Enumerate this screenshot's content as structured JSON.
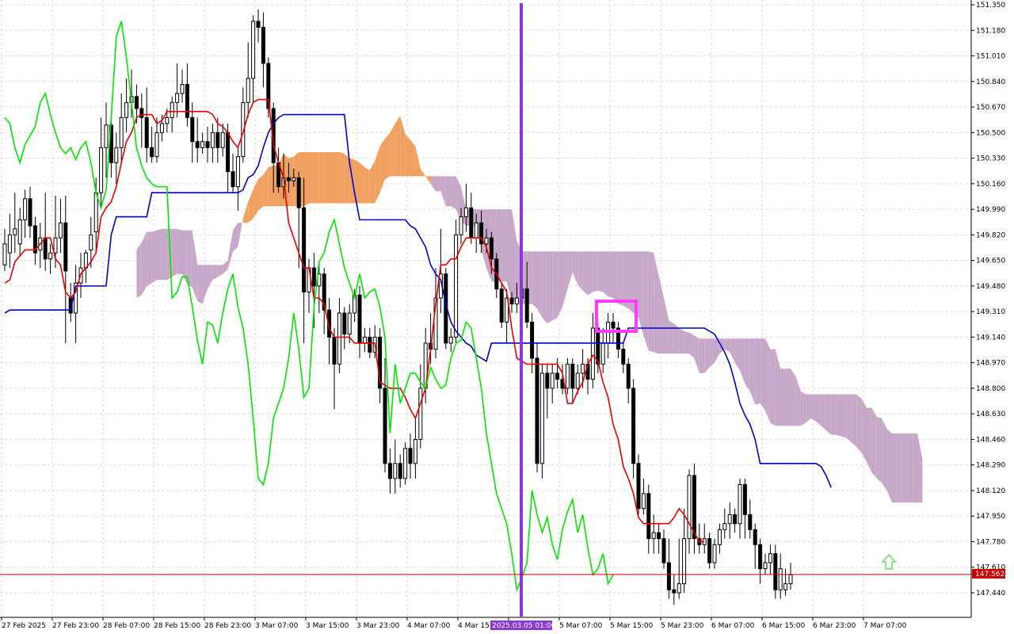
{
  "colors": {
    "background": "#ffffff",
    "grid": "#d9d9d9",
    "axis": "#000000",
    "candle_bull_fill": "#ffffff",
    "candle_bear_fill": "#000000",
    "candle_outline": "#000000",
    "tenkan": "#e60000",
    "kijun": "#0000c8",
    "chikou": "#00e600",
    "kumo_bull": "#f0a060",
    "kumo_bear": "#c8a8c8",
    "price_line": "#c80000",
    "cursor_line": "#8c38d8",
    "highlight_box": "#ff3cff",
    "arrow": "#66dd66"
  },
  "current_price": {
    "label": "147.562",
    "value": 147.562
  },
  "cursor": {
    "label": "2025.03.05 01:00"
  },
  "chart_data": {
    "type": "candlestick",
    "symbol": "",
    "title": "",
    "xlabel": "",
    "ylabel": "",
    "grid": true,
    "ylim": [
      147.3,
      151.4
    ],
    "x_ticks": [
      "27 Feb 2025",
      "27 Feb 23:00",
      "28 Feb 07:00",
      "28 Feb 15:00",
      "28 Feb 23:00",
      "3 Mar 07:00",
      "3 Mar 15:00",
      "3 Mar 23:00",
      "4 Mar 07:00",
      "4 Mar 15:00",
      "4 Mar 23:00",
      "5 Mar 07:00",
      "5 Mar 15:00",
      "5 Mar 23:00",
      "6 Mar 07:00",
      "6 Mar 15:00",
      "6 Mar 23:00",
      "7 Mar 07:00"
    ],
    "y_ticks": [
      "151.350",
      "151.180",
      "151.010",
      "150.840",
      "150.670",
      "150.500",
      "150.330",
      "150.160",
      "149.990",
      "149.820",
      "149.650",
      "149.480",
      "149.310",
      "149.140",
      "148.970",
      "148.800",
      "148.630",
      "148.460",
      "148.290",
      "148.120",
      "147.950",
      "147.780",
      "147.610",
      "147.440"
    ],
    "candles": [
      [
        149.62,
        149.76,
        149.58,
        149.86
      ],
      [
        149.7,
        149.82,
        149.6,
        149.96
      ],
      [
        149.82,
        149.86,
        149.7,
        150.1
      ],
      [
        149.76,
        149.92,
        149.68,
        150.0
      ],
      [
        149.92,
        150.06,
        149.8,
        150.12
      ],
      [
        150.06,
        149.88,
        149.8,
        150.14
      ],
      [
        149.88,
        149.7,
        149.62,
        149.94
      ],
      [
        149.72,
        149.8,
        149.6,
        149.9
      ],
      [
        149.8,
        149.66,
        149.58,
        150.1
      ],
      [
        149.66,
        149.7,
        149.56,
        149.76
      ],
      [
        149.7,
        149.8,
        149.6,
        150.08
      ],
      [
        149.8,
        149.9,
        149.7,
        150.06
      ],
      [
        149.9,
        149.58,
        149.1,
        150.08
      ],
      [
        149.4,
        149.3,
        149.24,
        149.5
      ],
      [
        149.3,
        149.5,
        149.1,
        149.62
      ],
      [
        149.5,
        149.6,
        149.4,
        149.7
      ],
      [
        149.6,
        149.7,
        149.5,
        149.72
      ],
      [
        149.72,
        149.82,
        149.6,
        149.94
      ],
      [
        149.84,
        150.1,
        149.7,
        150.2
      ],
      [
        150.1,
        150.4,
        150.0,
        150.6
      ],
      [
        150.4,
        150.55,
        150.2,
        150.7
      ],
      [
        150.55,
        150.3,
        150.2,
        150.62
      ],
      [
        150.3,
        150.4,
        150.16,
        150.5
      ],
      [
        150.4,
        150.6,
        150.3,
        150.76
      ],
      [
        150.6,
        150.7,
        150.5,
        150.86
      ],
      [
        150.7,
        150.74,
        150.6,
        150.92
      ],
      [
        150.74,
        150.66,
        150.56,
        150.82
      ],
      [
        150.66,
        150.6,
        150.4,
        150.76
      ],
      [
        150.6,
        150.4,
        150.3,
        150.8
      ],
      [
        150.4,
        150.34,
        150.3,
        150.54
      ],
      [
        150.34,
        150.5,
        150.3,
        150.6
      ],
      [
        150.5,
        150.56,
        150.44,
        150.62
      ],
      [
        150.56,
        150.6,
        150.5,
        150.66
      ],
      [
        150.6,
        150.7,
        150.5,
        150.74
      ],
      [
        150.7,
        150.76,
        150.6,
        150.96
      ],
      [
        150.76,
        150.82,
        150.7,
        150.92
      ],
      [
        150.82,
        150.6,
        150.54,
        150.96
      ],
      [
        150.6,
        150.44,
        150.3,
        150.7
      ],
      [
        150.44,
        150.4,
        150.3,
        150.6
      ],
      [
        150.4,
        150.44,
        150.36,
        150.5
      ],
      [
        150.44,
        150.4,
        150.3,
        150.54
      ],
      [
        150.4,
        150.5,
        150.3,
        150.56
      ],
      [
        150.5,
        150.4,
        150.3,
        150.6
      ],
      [
        150.4,
        150.5,
        150.34,
        150.56
      ],
      [
        150.5,
        150.24,
        150.1,
        150.56
      ],
      [
        150.24,
        150.14,
        150.1,
        150.36
      ],
      [
        150.14,
        150.34,
        149.98,
        150.4
      ],
      [
        150.34,
        150.7,
        150.3,
        150.8
      ],
      [
        150.7,
        150.86,
        150.6,
        151.1
      ],
      [
        150.86,
        151.24,
        150.7,
        151.28
      ],
      [
        151.24,
        151.2,
        151.1,
        151.32
      ],
      [
        151.2,
        150.96,
        150.8,
        151.3
      ],
      [
        150.96,
        150.66,
        150.6,
        151.0
      ],
      [
        150.66,
        150.3,
        150.1,
        150.7
      ],
      [
        150.3,
        150.14,
        150.1,
        150.4
      ],
      [
        150.14,
        150.2,
        150.06,
        150.36
      ],
      [
        150.2,
        150.18,
        150.1,
        150.3
      ],
      [
        150.18,
        150.2,
        150.14,
        150.26
      ],
      [
        150.2,
        150.0,
        149.6,
        150.24
      ],
      [
        150.0,
        149.44,
        149.1,
        150.2
      ],
      [
        149.44,
        149.6,
        149.3,
        149.66
      ],
      [
        149.6,
        149.48,
        149.2,
        149.7
      ],
      [
        149.48,
        149.56,
        149.3,
        149.64
      ],
      [
        149.56,
        149.32,
        149.16,
        149.6
      ],
      [
        149.32,
        149.14,
        148.96,
        149.4
      ],
      [
        149.14,
        148.96,
        148.66,
        149.2
      ],
      [
        148.96,
        149.3,
        148.9,
        149.4
      ],
      [
        149.3,
        149.16,
        149.06,
        149.34
      ],
      [
        149.16,
        149.3,
        149.1,
        149.36
      ],
      [
        149.3,
        149.42,
        149.24,
        149.46
      ],
      [
        149.42,
        149.1,
        149.0,
        149.48
      ],
      [
        149.1,
        149.14,
        149.04,
        149.2
      ],
      [
        149.14,
        149.04,
        149.0,
        149.2
      ],
      [
        149.04,
        149.14,
        149.0,
        149.22
      ],
      [
        149.14,
        148.8,
        148.7,
        149.2
      ],
      [
        148.8,
        148.3,
        148.24,
        149.0
      ],
      [
        148.3,
        148.2,
        148.1,
        148.4
      ],
      [
        148.2,
        148.3,
        148.1,
        148.46
      ],
      [
        148.3,
        148.2,
        148.14,
        148.36
      ],
      [
        148.2,
        148.4,
        148.16,
        148.44
      ],
      [
        148.4,
        148.3,
        148.2,
        148.5
      ],
      [
        148.3,
        148.46,
        148.2,
        148.6
      ],
      [
        148.46,
        148.8,
        148.4,
        148.96
      ],
      [
        148.8,
        149.1,
        148.7,
        149.2
      ],
      [
        149.1,
        149.06,
        148.96,
        149.3
      ],
      [
        149.06,
        149.4,
        149.0,
        149.6
      ],
      [
        149.4,
        149.56,
        149.3,
        149.86
      ],
      [
        149.56,
        149.1,
        149.06,
        149.6
      ],
      [
        149.1,
        149.14,
        149.04,
        149.2
      ],
      [
        149.14,
        149.82,
        149.1,
        149.92
      ],
      [
        149.82,
        149.94,
        149.76,
        150.0
      ],
      [
        149.94,
        150.0,
        149.84,
        150.16
      ],
      [
        150.0,
        149.8,
        149.76,
        150.1
      ],
      [
        149.8,
        149.9,
        149.7,
        149.96
      ],
      [
        149.9,
        149.76,
        149.7,
        149.98
      ],
      [
        149.76,
        149.8,
        149.7,
        149.86
      ],
      [
        149.8,
        149.66,
        149.56,
        149.84
      ],
      [
        149.66,
        149.46,
        149.4,
        149.7
      ],
      [
        149.46,
        149.24,
        149.2,
        149.5
      ],
      [
        149.24,
        149.4,
        149.1,
        149.46
      ],
      [
        149.4,
        149.36,
        149.3,
        149.44
      ],
      [
        149.36,
        149.4,
        149.3,
        149.5
      ],
      [
        149.4,
        149.46,
        149.3,
        149.56
      ],
      [
        149.46,
        149.24,
        149.2,
        149.64
      ],
      [
        149.24,
        149.0,
        148.9,
        149.3
      ],
      [
        149.0,
        148.3,
        148.24,
        149.1
      ],
      [
        148.3,
        148.9,
        148.2,
        148.96
      ],
      [
        148.9,
        148.8,
        148.6,
        148.96
      ],
      [
        148.8,
        148.9,
        148.7,
        148.96
      ],
      [
        148.9,
        148.86,
        148.8,
        149.0
      ],
      [
        148.86,
        148.8,
        148.76,
        148.96
      ],
      [
        148.8,
        148.96,
        148.76,
        149.0
      ],
      [
        148.96,
        148.8,
        148.7,
        149.0
      ],
      [
        148.8,
        148.9,
        148.76,
        148.96
      ],
      [
        148.9,
        148.96,
        148.8,
        149.06
      ],
      [
        148.96,
        148.86,
        148.76,
        149.0
      ],
      [
        148.86,
        149.2,
        148.8,
        149.3
      ],
      [
        149.2,
        148.96,
        148.9,
        149.24
      ],
      [
        148.96,
        149.1,
        148.9,
        149.2
      ],
      [
        149.1,
        149.24,
        149.0,
        149.3
      ],
      [
        149.24,
        149.2,
        149.1,
        149.3
      ],
      [
        149.2,
        149.06,
        149.0,
        149.24
      ],
      [
        149.06,
        148.96,
        148.9,
        149.1
      ],
      [
        148.96,
        148.8,
        148.7,
        149.0
      ],
      [
        148.8,
        148.3,
        148.2,
        148.86
      ],
      [
        148.3,
        148.0,
        147.96,
        148.36
      ],
      [
        148.0,
        148.1,
        147.96,
        148.2
      ],
      [
        148.1,
        147.8,
        147.7,
        148.16
      ],
      [
        147.8,
        147.84,
        147.7,
        147.96
      ],
      [
        147.84,
        147.8,
        147.7,
        147.9
      ],
      [
        147.8,
        147.64,
        147.6,
        147.86
      ],
      [
        147.64,
        147.46,
        147.4,
        147.8
      ],
      [
        147.46,
        147.44,
        147.36,
        147.56
      ],
      [
        147.44,
        147.5,
        147.4,
        147.8
      ],
      [
        147.5,
        147.8,
        147.44,
        148.0
      ],
      [
        147.8,
        148.22,
        147.7,
        148.26
      ],
      [
        148.22,
        147.8,
        147.7,
        148.3
      ],
      [
        147.8,
        147.76,
        147.7,
        147.9
      ],
      [
        147.76,
        147.8,
        147.7,
        147.9
      ],
      [
        147.8,
        147.64,
        147.6,
        147.84
      ],
      [
        147.64,
        147.76,
        147.6,
        147.8
      ],
      [
        147.76,
        147.86,
        147.7,
        147.9
      ],
      [
        147.86,
        147.9,
        147.8,
        148.0
      ],
      [
        147.9,
        147.96,
        147.8,
        148.04
      ],
      [
        147.96,
        147.9,
        147.84,
        148.0
      ],
      [
        147.9,
        148.16,
        147.8,
        148.2
      ],
      [
        148.16,
        147.96,
        147.8,
        148.2
      ],
      [
        147.96,
        147.86,
        147.8,
        148.06
      ],
      [
        147.86,
        147.76,
        147.6,
        147.9
      ],
      [
        147.76,
        147.6,
        147.5,
        147.8
      ],
      [
        147.6,
        147.64,
        147.56,
        147.7
      ],
      [
        147.64,
        147.7,
        147.56,
        147.76
      ],
      [
        147.7,
        147.46,
        147.4,
        147.76
      ],
      [
        147.46,
        147.6,
        147.4,
        147.7
      ],
      [
        147.46,
        147.5,
        147.42,
        147.6
      ],
      [
        147.5,
        147.56,
        147.46,
        147.64
      ]
    ],
    "tenkan": [
      149.5,
      149.52,
      149.64,
      149.68,
      149.72,
      149.72,
      149.72,
      149.76,
      149.8,
      149.8,
      149.66,
      149.62,
      149.44,
      149.4,
      149.44,
      149.56,
      149.6,
      149.64,
      149.7,
      149.94,
      150.0,
      150.04,
      150.14,
      150.3,
      150.44,
      150.5,
      150.6,
      150.62,
      150.62,
      150.62,
      150.56,
      150.58,
      150.64,
      150.64,
      150.64,
      150.64,
      150.64,
      150.64,
      150.64,
      150.64,
      150.64,
      150.62,
      150.56,
      150.54,
      150.5,
      150.44,
      150.4,
      150.5,
      150.62,
      150.7,
      150.72,
      150.72,
      150.72,
      150.42,
      150.3,
      150.2,
      149.9,
      149.8,
      149.7,
      149.6,
      149.6,
      149.4,
      149.4,
      149.36,
      149.2,
      149.14,
      149.14,
      149.14,
      149.14,
      149.1,
      149.1,
      149.1,
      149.1,
      149.1,
      148.84,
      148.82,
      148.8,
      148.8,
      148.8,
      148.74,
      148.66,
      148.6,
      148.7,
      148.8,
      149.06,
      149.36,
      149.62,
      149.62,
      149.66,
      149.66,
      149.74,
      149.8,
      149.8,
      149.8,
      149.8,
      149.74,
      149.6,
      149.56,
      149.5,
      149.44,
      149.2,
      149.0,
      148.98,
      148.96,
      148.96,
      148.96,
      148.96,
      148.96,
      148.96,
      148.96,
      148.9,
      148.7,
      148.7,
      148.78,
      148.84,
      148.96,
      149.02,
      148.98,
      148.84,
      148.74,
      148.56,
      148.46,
      148.28,
      148.2,
      148.1,
      147.94,
      147.9,
      147.9,
      147.9,
      147.9,
      147.9,
      147.9,
      147.94,
      148.0,
      147.96,
      147.9,
      147.84,
      147.78,
      147.78
    ],
    "kijun": [
      149.3,
      149.32,
      149.32,
      149.32,
      149.32,
      149.32,
      149.32,
      149.32,
      149.32,
      149.32,
      149.32,
      149.32,
      149.32,
      149.32,
      149.48,
      149.48,
      149.48,
      149.48,
      149.48,
      149.48,
      149.48,
      149.82,
      149.94,
      149.94,
      149.94,
      149.94,
      149.94,
      149.94,
      149.94,
      150.1,
      150.1,
      150.1,
      150.1,
      150.1,
      150.1,
      150.1,
      150.1,
      150.1,
      150.1,
      150.1,
      150.1,
      150.1,
      150.1,
      150.1,
      150.1,
      150.1,
      150.1,
      150.12,
      150.2,
      150.22,
      150.28,
      150.4,
      150.5,
      150.56,
      150.6,
      150.62,
      150.62,
      150.62,
      150.62,
      150.62,
      150.62,
      150.62,
      150.62,
      150.62,
      150.62,
      150.62,
      150.62,
      150.62,
      150.3,
      150.1,
      149.92,
      149.92,
      149.92,
      149.92,
      149.92,
      149.92,
      149.92,
      149.92,
      149.92,
      149.92,
      149.88,
      149.86,
      149.8,
      149.74,
      149.62,
      149.56,
      149.52,
      149.36,
      149.24,
      149.18,
      149.14,
      149.1,
      149.08,
      149.02,
      149.0,
      148.98,
      149.1,
      149.1,
      149.1,
      149.1,
      149.1,
      149.1,
      149.1,
      149.1,
      149.1,
      149.1,
      149.1,
      149.1,
      149.1,
      149.1,
      149.1,
      149.1,
      149.1,
      149.1,
      149.1,
      149.1,
      149.1,
      149.1,
      149.1,
      149.1,
      149.1,
      149.1,
      149.1,
      149.2,
      149.2,
      149.2,
      149.2,
      149.2,
      149.2,
      149.2,
      149.2,
      149.2,
      149.2,
      149.2,
      149.2,
      149.2,
      149.2,
      149.2,
      149.2,
      149.18,
      149.16,
      149.1,
      149.04,
      148.96,
      148.84,
      148.7,
      148.62,
      148.56,
      148.46,
      148.3,
      148.3,
      148.3,
      148.3,
      148.3,
      148.3,
      148.3,
      148.3,
      148.3,
      148.3,
      148.3,
      148.3,
      148.28,
      148.22,
      148.14
    ],
    "chikou": [
      150.6,
      150.56,
      150.4,
      150.3,
      150.42,
      150.48,
      150.54,
      150.7,
      150.76,
      150.62,
      150.5,
      150.4,
      150.36,
      150.4,
      150.32,
      150.4,
      150.44,
      150.3,
      150.1,
      150.0,
      150.12,
      150.6,
      151.14,
      151.24,
      151.0,
      150.7,
      150.4,
      150.28,
      150.2,
      150.16,
      150.14,
      150.14,
      150.14,
      149.4,
      149.44,
      149.54,
      149.54,
      149.34,
      149.12,
      148.96,
      149.24,
      149.22,
      149.1,
      149.3,
      149.46,
      149.56,
      149.34,
      149.2,
      148.96,
      148.6,
      148.2,
      148.16,
      148.3,
      148.6,
      148.7,
      148.8,
      149.0,
      149.3,
      149.06,
      148.74,
      148.8,
      149.34,
      149.64,
      149.7,
      149.84,
      149.92,
      149.76,
      149.6,
      149.5,
      149.4,
      149.56,
      149.4,
      149.44,
      149.46,
      149.34,
      149.14,
      148.5,
      148.96,
      148.7,
      148.8,
      148.9,
      148.9,
      148.84,
      148.8,
      148.94,
      148.86,
      148.8,
      148.82,
      149.0,
      149.1,
      149.12,
      149.24,
      149.2,
      149.0,
      148.8,
      148.5,
      148.3,
      148.1,
      148.0,
      147.9,
      147.7,
      147.46,
      147.54,
      147.64,
      148.12,
      147.96,
      147.84,
      147.94,
      147.76,
      147.66,
      147.86,
      147.98,
      148.06,
      147.84,
      147.96,
      147.74,
      147.56,
      147.6,
      147.7,
      147.5,
      147.56
    ]
  }
}
